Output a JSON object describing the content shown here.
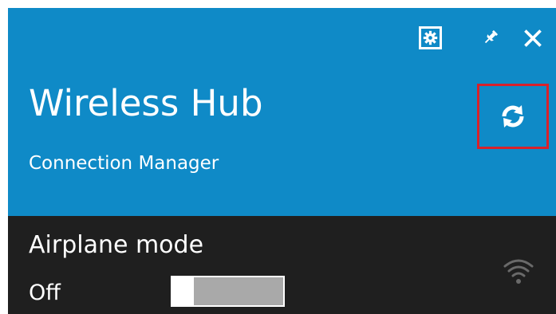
{
  "header": {
    "title": "Wireless Hub",
    "subtitle": "Connection Manager",
    "settings_icon": "gear-icon",
    "pin_icon": "pin-icon",
    "close_icon": "close-icon",
    "refresh_icon": "refresh-icon",
    "accent_color": "#0f8ac7",
    "highlight_color": "#d8212a"
  },
  "airplane_mode": {
    "label": "Airplane mode",
    "state": "Off",
    "on": false
  },
  "status": {
    "wifi_icon": "wifi-icon"
  }
}
